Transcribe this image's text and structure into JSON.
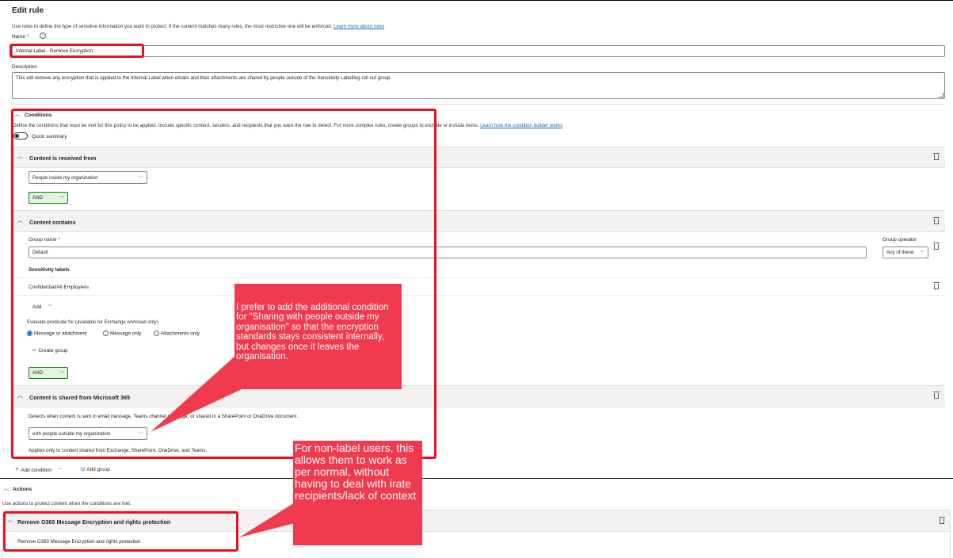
{
  "header": {
    "title": "Edit rule",
    "intro": "Use rules to define the type of sensitive information you want to protect. If the content matches many rules, the most restrictive one will be enforced.",
    "learn_more": "Learn more about rules"
  },
  "name_field": {
    "label": "Name",
    "required_mark": "*",
    "info_icon": "info-icon",
    "value": "Internal Label - Remove Encryption"
  },
  "description_field": {
    "label": "Description",
    "value": "This will remove any encryption that is applied to the Internal Label when emails and their attachments are shared by people outside of the Sensitivity Labelling roll out group."
  },
  "conditions": {
    "title": "Conditions",
    "description_a": "Define the conditions that must be met for this policy to be applied. Include specific content, senders, and recipients that you want the rule to detect. For more complex rules, ",
    "description_b": "create groups to exclude or include items.",
    "learn_link": "Learn how the condition builder works",
    "quick_summary": "Quick summary",
    "received_from": {
      "title": "Content is received from",
      "selected": "People inside my organization",
      "operator": "AND"
    },
    "contains": {
      "title": "Content contains",
      "group_name_label": "Group name",
      "group_name_value": "Default",
      "group_operator_label": "Group operator",
      "group_operator_value": "Any of these",
      "sensitivity_labels_heading": "Sensitivity labels",
      "label_item": "Confidential/All Employees",
      "add_label": "Add",
      "evaluate_label": "Evaluate predicate for (available for Exchange workload only)",
      "radio_options": [
        "Message or attachment",
        "Message only",
        "Attachments only"
      ],
      "radio_selected": "Message or attachment",
      "create_group": "Create group",
      "operator": "AND"
    },
    "shared_from": {
      "title": "Content is shared from Microsoft 365",
      "desc_a": "Detects when content is sent in email message, Teams cha",
      "desc_b": "nnel message, or shared in a SharePoint or OneDrive document.",
      "selected": "with people outside my organization",
      "footnote": "Applies only to content shared from Exchange, SharePoint, OneDrive, and Teams."
    },
    "add_condition": "Add condition",
    "add_group": "Add group"
  },
  "actions": {
    "title": "Actions",
    "description": "Use actions to protect content when the conditions are met.",
    "item_title": "Remove O365 Message Encryption and rights protection",
    "item_body": "Remove O365 Message Encryption and rights protection"
  },
  "callouts": {
    "first": "I prefer to add the additional condition for \"Sharing with people outside my organisation\" so that the encryption standards stays consistent internally, but changes once it leaves the organisation.",
    "second": "For non-label users, this allows them to work as per normal, without having to deal with irate recipients/lack of context"
  },
  "colors": {
    "link": "#0f6cbd",
    "highlight": "#e81123",
    "callout": "#f03a4e",
    "and_border": "#107c10",
    "and_fill": "#dff6dd"
  },
  "icons": [
    "info-icon",
    "chevron-up-icon",
    "chevron-down-icon",
    "trash-icon",
    "plus-icon",
    "group-icon",
    "create-group-icon"
  ]
}
